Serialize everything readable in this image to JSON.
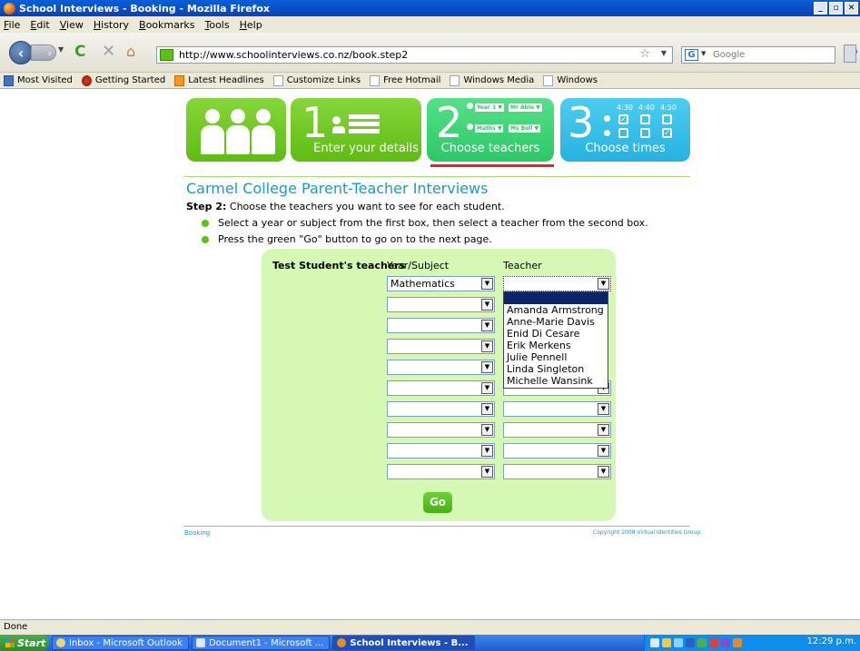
{
  "window": {
    "title": "School Interviews - Booking - Mozilla Firefox"
  },
  "menu": [
    "File",
    "Edit",
    "View",
    "History",
    "Bookmarks",
    "Tools",
    "Help"
  ],
  "nav": {
    "url": "http://www.schoolinterviews.co.nz/book.step2",
    "search_placeholder": "Google"
  },
  "bookmarks": [
    "Most Visited",
    "Getting Started",
    "Latest Headlines",
    "Customize Links",
    "Free Hotmail",
    "Windows Media",
    "Windows"
  ],
  "steps": {
    "step1_num": "1",
    "step1_label": "Enter your details",
    "step2_num": "2",
    "step2_label": "Choose teachers",
    "step2_mini": [
      "Year 1 ▼",
      "Mr Able ▼",
      "Maths ▼",
      "Ms Bell ▼"
    ],
    "step3_num": "3",
    "step3_label": "Choose times",
    "step3_times": [
      "4:30",
      "4:40",
      "4:50"
    ]
  },
  "page": {
    "title": "Carmel College Parent-Teacher Interviews",
    "step_bold": "Step 2:",
    "step_text": " Choose the teachers you want to see for each student.",
    "bullet1": "Select a year or subject from the first box, then select a teacher from the second box.",
    "bullet2": "Press the green \"Go\" button to go on to the next page."
  },
  "form": {
    "student_label": "Test Student's teachers",
    "col_subject": "Year/Subject",
    "col_teacher": "Teacher",
    "first_subject": "Mathematics",
    "dropdown_options": [
      "Amanda Armstrong",
      "Anne-Marie Davis",
      "Enid Di Cesare",
      "Erik Merkens",
      "Julie Pennell",
      "Linda Singleton",
      "Michelle Wansink"
    ],
    "go_label": "Go"
  },
  "footer": {
    "left": "Booking",
    "right": "Copyright 2008 Virtual Identities Group"
  },
  "status": {
    "text": "Done"
  },
  "taskbar": {
    "start": "Start",
    "tasks": [
      "Inbox - Microsoft Outlook",
      "Document1 - Microsoft ...",
      "School Interviews - B..."
    ],
    "clock": "12:29 p.m."
  }
}
